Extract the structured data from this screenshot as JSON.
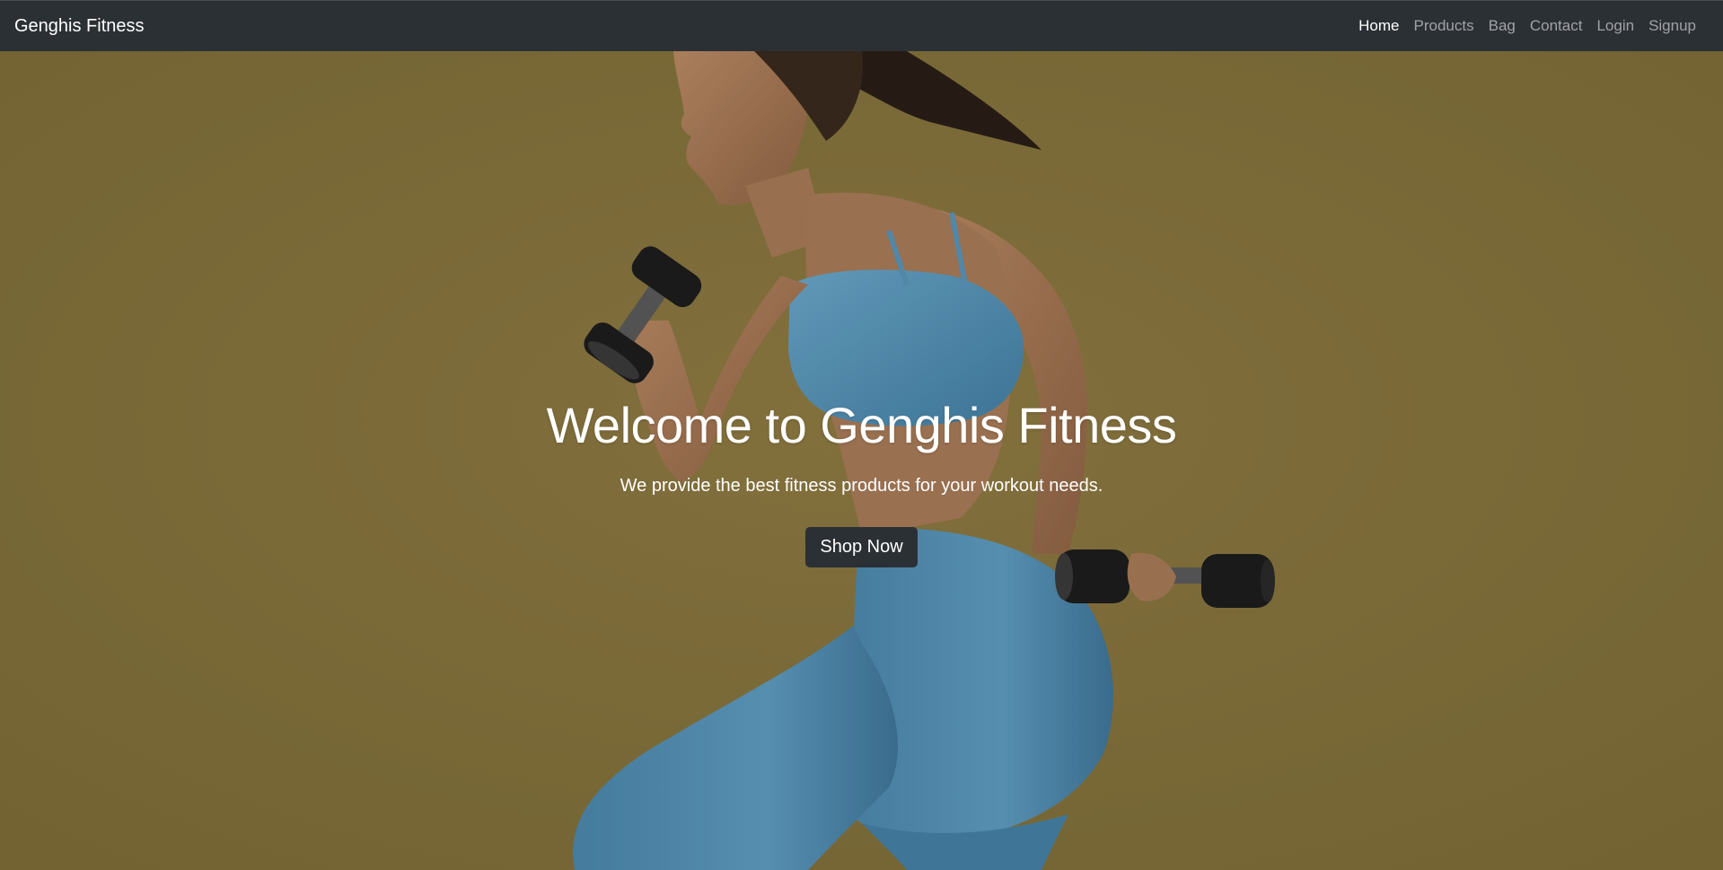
{
  "navbar": {
    "brand": "Genghis Fitness",
    "links": [
      {
        "label": "Home",
        "active": true
      },
      {
        "label": "Products",
        "active": false
      },
      {
        "label": "Bag",
        "active": false
      },
      {
        "label": "Contact",
        "active": false
      },
      {
        "label": "Login",
        "active": false
      },
      {
        "label": "Signup",
        "active": false
      }
    ]
  },
  "hero": {
    "title": "Welcome to Genghis Fitness",
    "subtitle": "We provide the best fitness products for your workout needs.",
    "cta_label": "Shop Now",
    "image_icon": "woman-with-dumbbells-photo"
  },
  "colors": {
    "navbar_bg": "#2b3035",
    "hero_bg": "#86743e",
    "outfit": "#5a93b6",
    "button_bg": "#2b3035"
  }
}
